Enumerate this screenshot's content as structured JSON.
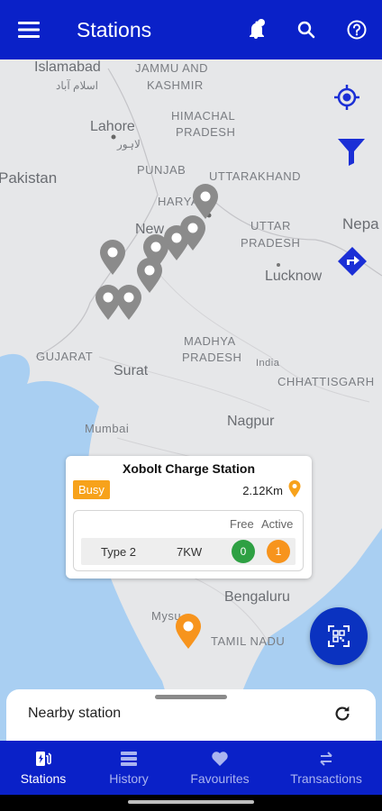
{
  "appbar": {
    "title": "Stations"
  },
  "map": {
    "labels": {
      "islamabad": "Islamabad",
      "islamabad_ur": "اسلام آباد",
      "jk1": "JAMMU AND",
      "jk2": "KASHMIR",
      "lahore": "Lahore",
      "lahore_ur": "لاہور",
      "hp1": "HIMACHAL",
      "hp2": "PRADESH",
      "pakistan": "Pakistan",
      "punjab": "PUNJAB",
      "uttarakhand": "UTTARAKHAND",
      "harya": "HARYA",
      "nepal": "Nepa",
      "new": "New",
      "up1": "UTTAR",
      "up2": "PRADESH",
      "lucknow": "Lucknow",
      "mp1": "MADHYA",
      "mp2": "PRADESH",
      "india": "India",
      "gujarat": "GUJARAT",
      "surat": "Surat",
      "chhattisgarh": "CHHATTISGARH",
      "mumbai": "Mumbai",
      "nagpur": "Nagpur",
      "bengaluru": "Bengaluru",
      "mysuru": "Mysu",
      "tamilnadu": "TAMIL NADU"
    }
  },
  "popup": {
    "name": "Xobolt Charge Station",
    "status": "Busy",
    "distance": "2.12Km",
    "free_header": "Free",
    "active_header": "Active",
    "connector": {
      "type": "Type 2",
      "power": "7KW",
      "free": "0",
      "active": "1"
    }
  },
  "sheet": {
    "label": "Nearby station"
  },
  "nav": {
    "stations": "Stations",
    "history": "History",
    "favourites": "Favourites",
    "transactions": "Transactions"
  },
  "colors": {
    "primary": "#0a21c8",
    "busy": "#f7a21b",
    "free": "#2ea043",
    "active": "#f7941d"
  }
}
